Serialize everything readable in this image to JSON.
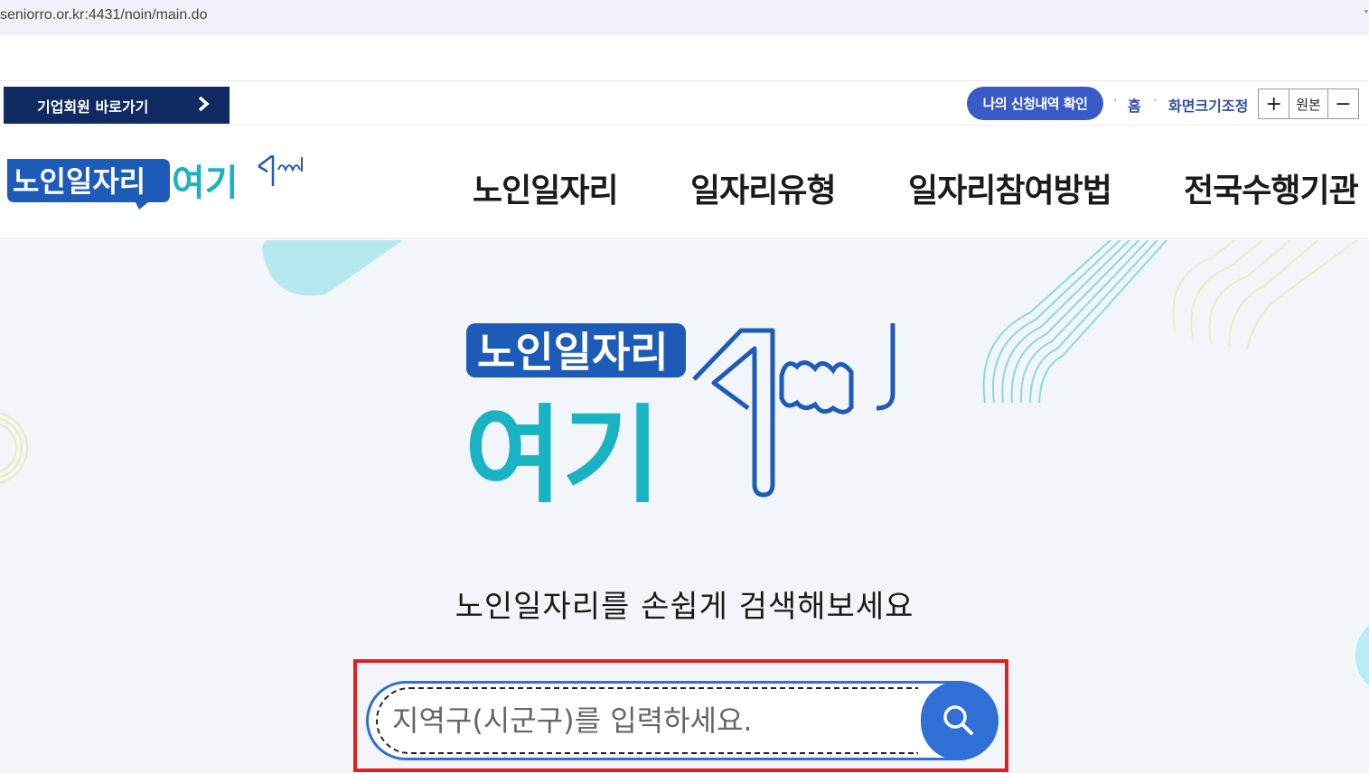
{
  "browser": {
    "url": "seniorro.or.kr:4431/noin/main.do",
    "dropdown_glyph": "˅"
  },
  "utility_bar": {
    "corporate_button": "기업회원 바로가기",
    "corporate_arrow": "›",
    "apply_history_button": "나의 신청내역 확인",
    "home_link": "홈",
    "font_size_label": "화면크기조정",
    "zoom_in": "+",
    "zoom_original": "원본",
    "zoom_out": "−",
    "separator": "·"
  },
  "header": {
    "logo_text_top": "노인일자리",
    "logo_text_bottom": "여기",
    "nav": [
      {
        "label": "노인일자리"
      },
      {
        "label": "일자리유형"
      },
      {
        "label": "일자리참여방법"
      },
      {
        "label": "전국수행기관"
      }
    ]
  },
  "hero": {
    "logo_text_top": "노인일자리",
    "logo_text_bottom": "여기",
    "tagline": "노인일자리를 손쉽게 검색해보세요",
    "search_placeholder": "지역구(시군구)를 입력하세요."
  },
  "icons": {
    "search": "search-icon",
    "chevron": "chevron-right-icon"
  },
  "colors": {
    "navy": "#0f2a60",
    "brand_blue": "#1d5bb8",
    "teal": "#1ab3c4",
    "search_blue": "#2f6fd6",
    "apply_blue": "#3a5bc7"
  }
}
